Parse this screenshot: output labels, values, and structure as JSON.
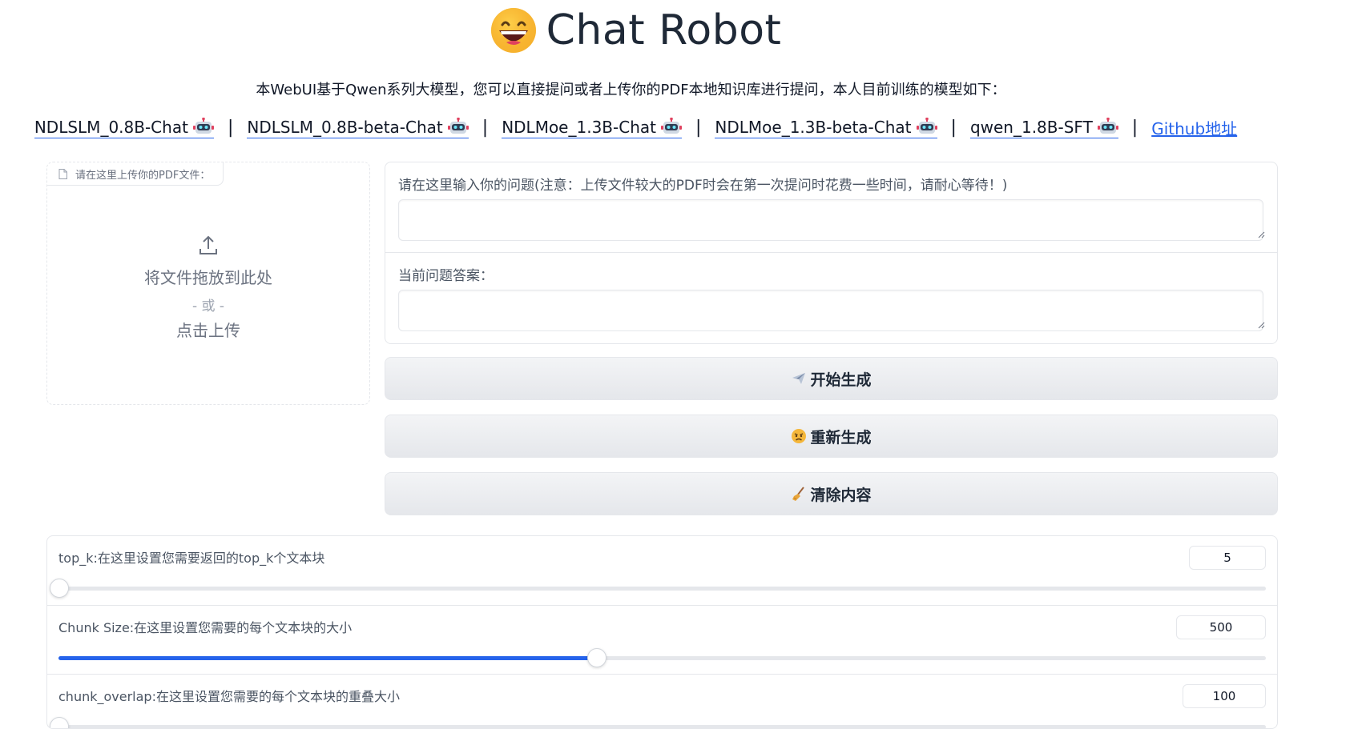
{
  "header": {
    "title": "Chat Robot",
    "description": "本WebUI基于Qwen系列大模型，您可以直接提问或者上传你的PDF本地知识库进行提问，本人目前训练的模型如下：",
    "models": [
      {
        "label": "NDLSLM_0.8B-Chat"
      },
      {
        "label": "NDLSLM_0.8B-beta-Chat"
      },
      {
        "label": "NDLMoe_1.3B-Chat"
      },
      {
        "label": "NDLMoe_1.3B-beta-Chat"
      },
      {
        "label": "qwen_1.8B-SFT"
      }
    ],
    "separator": "|",
    "github_label": "Github地址"
  },
  "upload": {
    "label": "请在这里上传你的PDF文件：",
    "drop_text": "将文件拖放到此处",
    "or_text": "- 或 -",
    "click_text": "点击上传"
  },
  "qa": {
    "question_label": "请在这里输入你的问题(注意：上传文件较大的PDF时会在第一次提问时花费一些时间，请耐心等待！)",
    "question_value": "",
    "answer_label": "当前问题答案：",
    "answer_value": ""
  },
  "buttons": {
    "generate": "开始生成",
    "regenerate": "重新生成",
    "clear": "清除内容"
  },
  "sliders": [
    {
      "label": "top_k:在这里设置您需要返回的top_k个文本块",
      "value": "5",
      "fraction": 0.0
    },
    {
      "label": "Chunk Size:在这里设置您需要的每个文本块的大小",
      "value": "500",
      "fraction": 0.445
    },
    {
      "label": "chunk_overlap:在这里设置您需要的每个文本块的重叠大小",
      "value": "100",
      "fraction": 0.0
    }
  ],
  "colors": {
    "accent": "#2563eb",
    "border": "#e5e7eb",
    "button_bg": "#e5e7eb"
  },
  "icons": {
    "title": "grinning-face-icon",
    "model": "robot-icon",
    "upload": "upload-icon",
    "generate": "airplane-icon",
    "regenerate": "angry-face-icon",
    "clear": "broom-icon"
  }
}
